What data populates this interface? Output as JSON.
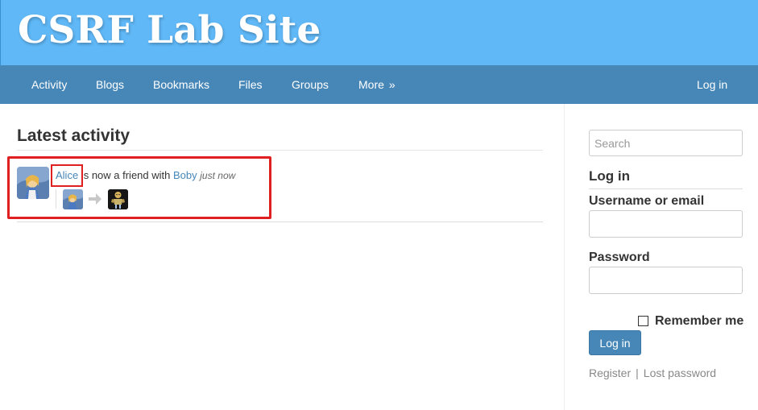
{
  "site": {
    "title": "CSRF Lab Site"
  },
  "nav": {
    "items": [
      "Activity",
      "Blogs",
      "Bookmarks",
      "Files",
      "Groups"
    ],
    "more_label": "More",
    "more_arrow": "»",
    "login_label": "Log in"
  },
  "main": {
    "heading": "Latest activity",
    "activity": {
      "subject": "Alice",
      "verb": "is now a friend with",
      "object": "Boby",
      "time": "just now"
    }
  },
  "sidebar": {
    "search_placeholder": "Search",
    "login_heading": "Log in",
    "username_label": "Username or email",
    "password_label": "Password",
    "remember_label": "Remember me",
    "login_button": "Log in",
    "register_link": "Register",
    "separator": "|",
    "lost_password_link": "Lost password"
  },
  "colors": {
    "header_bg": "#60b8f7",
    "nav_bg": "#4787b8",
    "link": "#4787b8",
    "highlight": "#e02020"
  }
}
